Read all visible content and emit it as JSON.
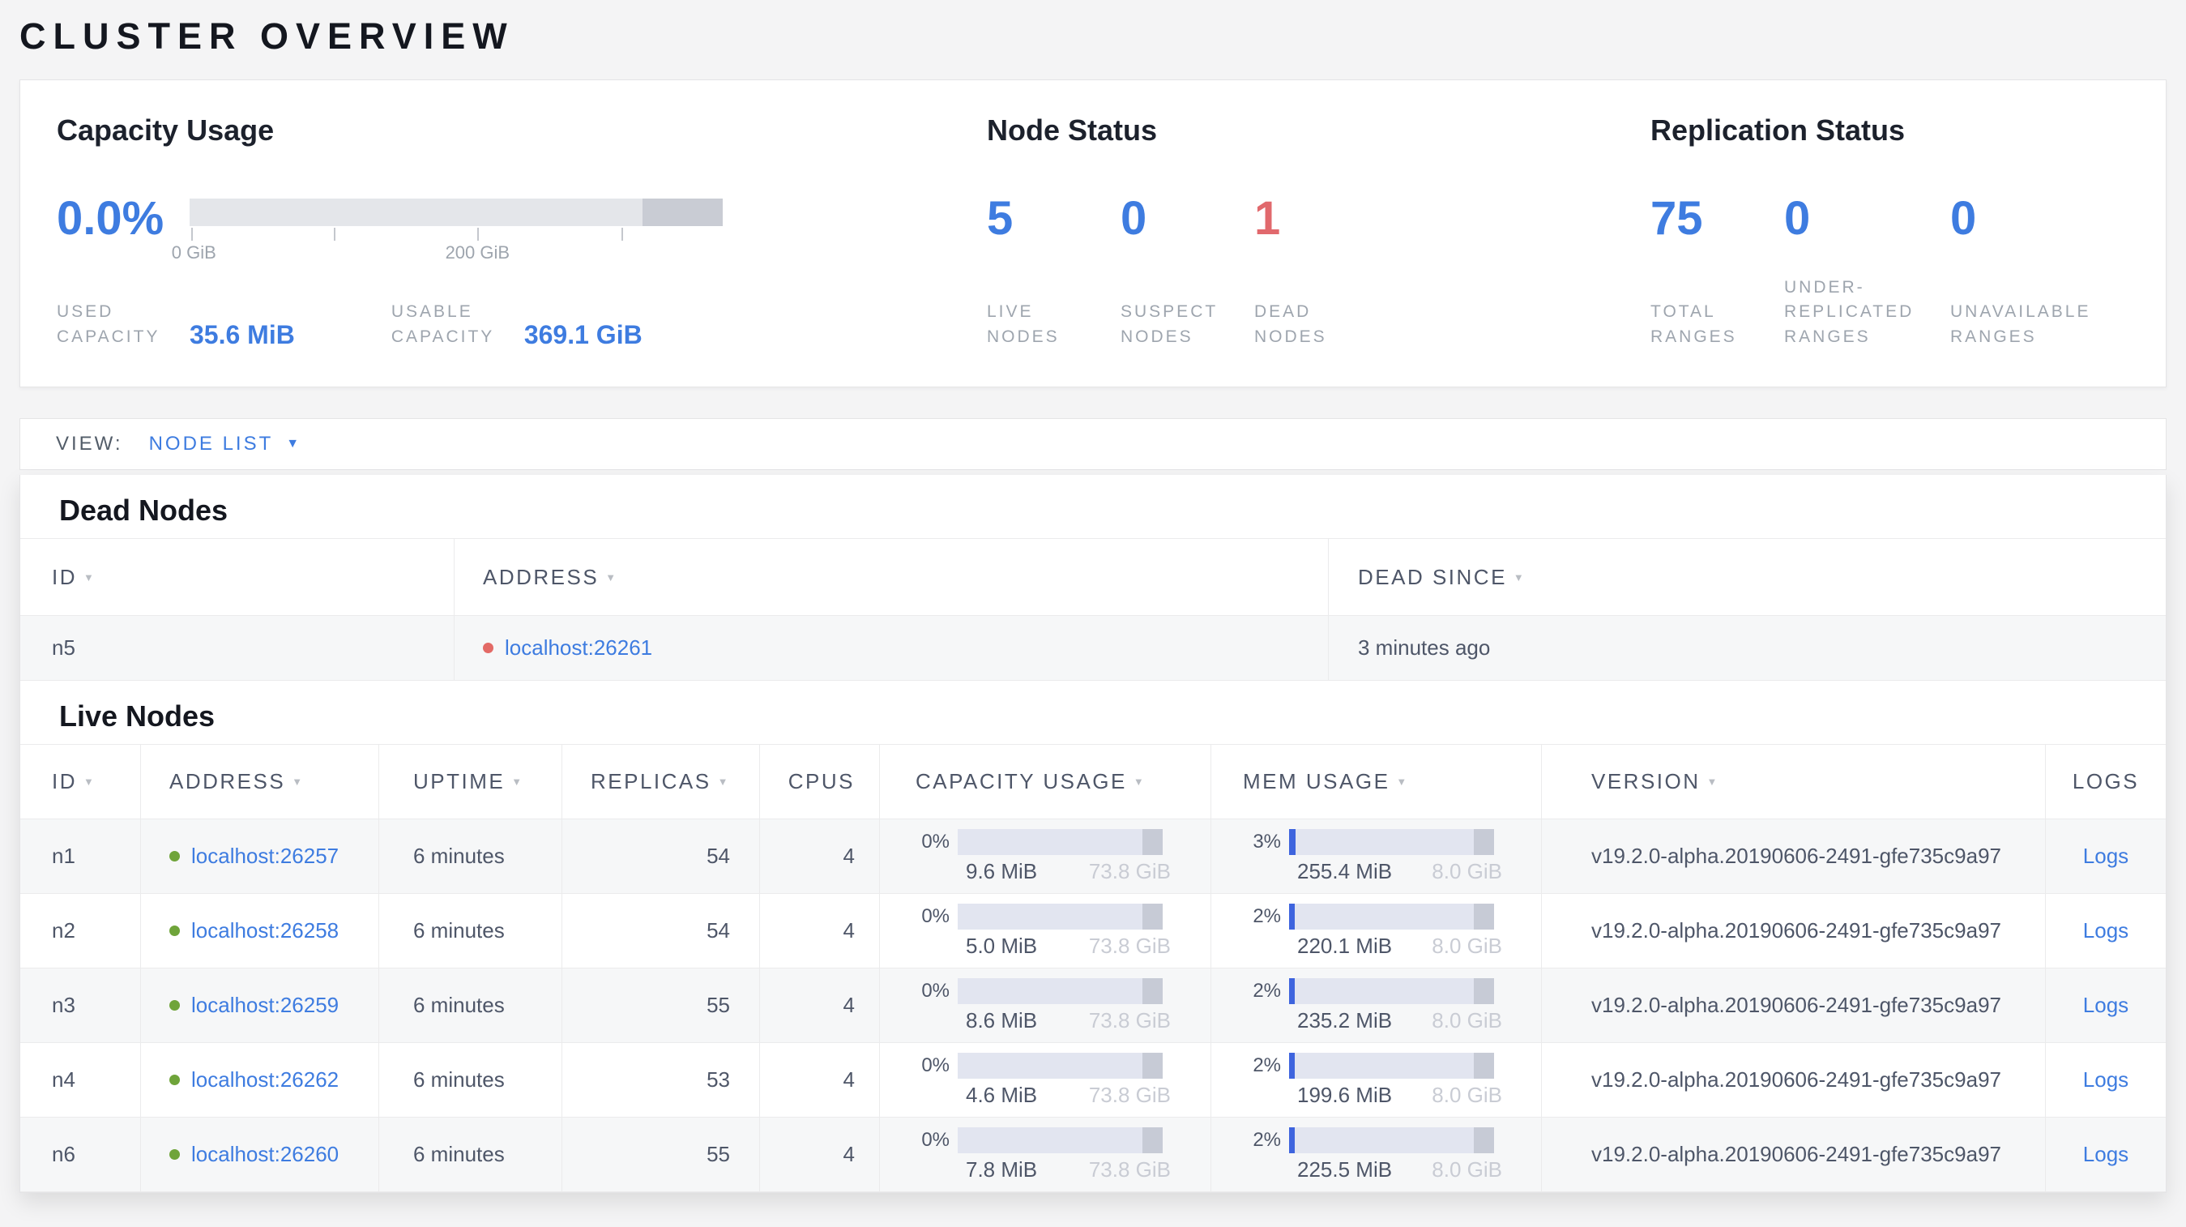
{
  "page": {
    "title": "CLUSTER OVERVIEW"
  },
  "summary": {
    "capacity": {
      "title": "Capacity Usage",
      "percent": "0.0%",
      "axis_labels": [
        "0 GiB",
        "200 GiB"
      ],
      "bar": {
        "endcap_start_pct": 85
      },
      "used": {
        "label": "USED CAPACITY",
        "value": "35.6 MiB"
      },
      "usable": {
        "label": "USABLE CAPACITY",
        "value": "369.1 GiB"
      }
    },
    "node_status": {
      "title": "Node Status",
      "stats": [
        {
          "value": "5",
          "label": "LIVE NODES",
          "tone": "blue"
        },
        {
          "value": "0",
          "label": "SUSPECT NODES",
          "tone": "blue"
        },
        {
          "value": "1",
          "label": "DEAD NODES",
          "tone": "red"
        }
      ]
    },
    "replication": {
      "title": "Replication Status",
      "stats": [
        {
          "value": "75",
          "label": "TOTAL RANGES",
          "tone": "blue"
        },
        {
          "value": "0",
          "label": "UNDER-REPLICATED RANGES",
          "tone": "blue"
        },
        {
          "value": "0",
          "label": "UNAVAILABLE RANGES",
          "tone": "blue"
        }
      ]
    }
  },
  "view_bar": {
    "label": "VIEW:",
    "selected": "NODE LIST",
    "caret_icon": "chevron-down"
  },
  "dead_nodes": {
    "heading": "Dead Nodes",
    "columns": [
      {
        "label": "ID",
        "sortable": true
      },
      {
        "label": "ADDRESS",
        "sortable": true
      },
      {
        "label": "DEAD SINCE",
        "sortable": true
      }
    ],
    "rows": [
      {
        "id": "n5",
        "status_icon": "dead-dot",
        "address": "localhost:26261",
        "dead_since": "3 minutes ago"
      }
    ]
  },
  "live_nodes": {
    "heading": "Live Nodes",
    "columns": [
      {
        "label": "ID",
        "sortable": true
      },
      {
        "label": "ADDRESS",
        "sortable": true
      },
      {
        "label": "UPTIME",
        "sortable": true
      },
      {
        "label": "REPLICAS",
        "sortable": true
      },
      {
        "label": "CPUS",
        "sortable": false
      },
      {
        "label": "CAPACITY USAGE",
        "sortable": true
      },
      {
        "label": "MEM USAGE",
        "sortable": true
      },
      {
        "label": "VERSION",
        "sortable": true
      },
      {
        "label": "LOGS",
        "sortable": false
      }
    ],
    "rows": [
      {
        "id": "n1",
        "status_icon": "live-dot",
        "address": "localhost:26257",
        "uptime": "6 minutes",
        "replicas": "54",
        "cpus": "4",
        "capacity": {
          "percent": "0%",
          "used": "9.6 MiB",
          "total": "73.8 GiB"
        },
        "mem": {
          "percent": "3%",
          "used": "255.4 MiB",
          "total": "8.0 GiB"
        },
        "version": "v19.2.0-alpha.20190606-2491-gfe735c9a97",
        "logs_label": "Logs"
      },
      {
        "id": "n2",
        "status_icon": "live-dot",
        "address": "localhost:26258",
        "uptime": "6 minutes",
        "replicas": "54",
        "cpus": "4",
        "capacity": {
          "percent": "0%",
          "used": "5.0 MiB",
          "total": "73.8 GiB"
        },
        "mem": {
          "percent": "2%",
          "used": "220.1 MiB",
          "total": "8.0 GiB"
        },
        "version": "v19.2.0-alpha.20190606-2491-gfe735c9a97",
        "logs_label": "Logs"
      },
      {
        "id": "n3",
        "status_icon": "live-dot",
        "address": "localhost:26259",
        "uptime": "6 minutes",
        "replicas": "55",
        "cpus": "4",
        "capacity": {
          "percent": "0%",
          "used": "8.6 MiB",
          "total": "73.8 GiB"
        },
        "mem": {
          "percent": "2%",
          "used": "235.2 MiB",
          "total": "8.0 GiB"
        },
        "version": "v19.2.0-alpha.20190606-2491-gfe735c9a97",
        "logs_label": "Logs"
      },
      {
        "id": "n4",
        "status_icon": "live-dot",
        "address": "localhost:26262",
        "uptime": "6 minutes",
        "replicas": "53",
        "cpus": "4",
        "capacity": {
          "percent": "0%",
          "used": "4.6 MiB",
          "total": "73.8 GiB"
        },
        "mem": {
          "percent": "2%",
          "used": "199.6 MiB",
          "total": "8.0 GiB"
        },
        "version": "v19.2.0-alpha.20190606-2491-gfe735c9a97",
        "logs_label": "Logs"
      },
      {
        "id": "n6",
        "status_icon": "live-dot",
        "address": "localhost:26260",
        "uptime": "6 minutes",
        "replicas": "55",
        "cpus": "4",
        "capacity": {
          "percent": "0%",
          "used": "7.8 MiB",
          "total": "73.8 GiB"
        },
        "mem": {
          "percent": "2%",
          "used": "225.5 MiB",
          "total": "8.0 GiB"
        },
        "version": "v19.2.0-alpha.20190606-2491-gfe735c9a97",
        "logs_label": "Logs"
      }
    ]
  },
  "colors": {
    "accent_blue": "#3e7ce0",
    "mem_fill_blue": "#3e64de",
    "danger_red": "#e1696d",
    "live_green": "#6fa43a",
    "bar_bg": "#e2e5f0",
    "bar_endcap": "#c8ccd6"
  }
}
